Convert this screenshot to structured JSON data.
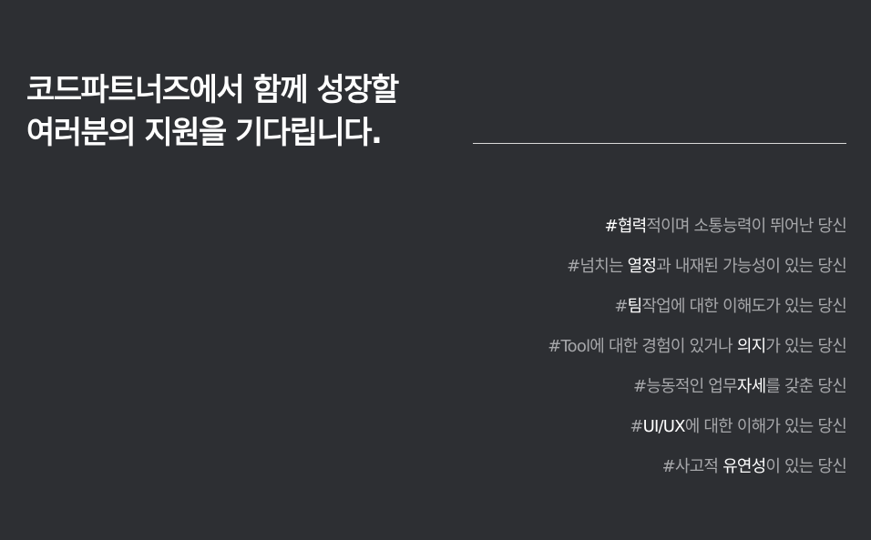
{
  "headline": {
    "line1": "코드파트너즈에서 함께 성장할",
    "line2": "여러분의 지원을 기다립니다."
  },
  "traits": [
    {
      "parts": [
        {
          "text": "#협력",
          "hl": true
        },
        {
          "text": "적이며 소통능력이 뛰어난 당신",
          "hl": false
        }
      ]
    },
    {
      "parts": [
        {
          "text": "#넘치는 ",
          "hl": false
        },
        {
          "text": "열정",
          "hl": true
        },
        {
          "text": "과 내재된 가능성이 있는 당신",
          "hl": false
        }
      ]
    },
    {
      "parts": [
        {
          "text": "#",
          "hl": false
        },
        {
          "text": "팀",
          "hl": true
        },
        {
          "text": "작업에 대한 이해도가 있는 당신",
          "hl": false
        }
      ]
    },
    {
      "parts": [
        {
          "text": "#Tool에 대한 경험이 있거나 ",
          "hl": false
        },
        {
          "text": "의지",
          "hl": true
        },
        {
          "text": "가 있는 당신",
          "hl": false
        }
      ]
    },
    {
      "parts": [
        {
          "text": "#능동적인 업무",
          "hl": false
        },
        {
          "text": "자세",
          "hl": true
        },
        {
          "text": "를 갖춘 당신",
          "hl": false
        }
      ]
    },
    {
      "parts": [
        {
          "text": "#",
          "hl": false
        },
        {
          "text": "UI/UX",
          "hl": true
        },
        {
          "text": "에 대한 이해가 있는 당신",
          "hl": false
        }
      ]
    },
    {
      "parts": [
        {
          "text": "#사고적 ",
          "hl": false
        },
        {
          "text": "유연성",
          "hl": true
        },
        {
          "text": "이 있는 당신",
          "hl": false
        }
      ]
    }
  ]
}
